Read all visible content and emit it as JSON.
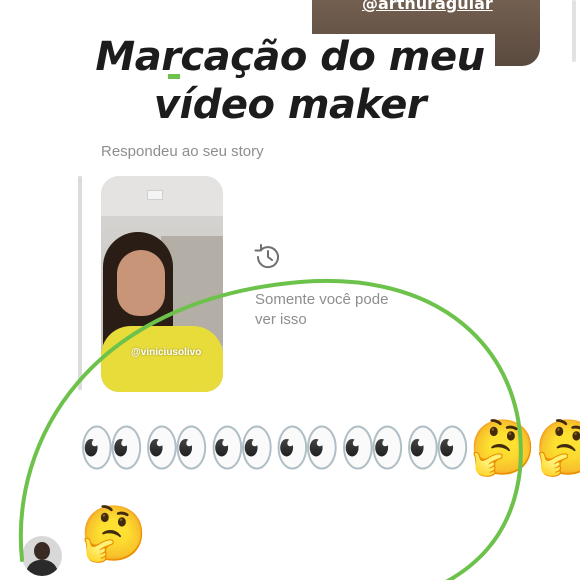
{
  "top_story": {
    "mention": "@arthuraguiar"
  },
  "headline": {
    "line1": "Marcação do meu",
    "line2": "vídeo maker",
    "accent_color": "#6cc24a"
  },
  "reply": {
    "label": "Respondeu ao seu story"
  },
  "story_card": {
    "mention": "@viniciusolivo"
  },
  "visibility": {
    "icon": "clock-history-icon",
    "text": "Somente você pode ver isso"
  },
  "message": {
    "row1": "👀👀👀👀👀👀🤔🤔",
    "row2": "🤔"
  },
  "annotation": {
    "color": "#6cc24a",
    "shape": "ellipse"
  }
}
